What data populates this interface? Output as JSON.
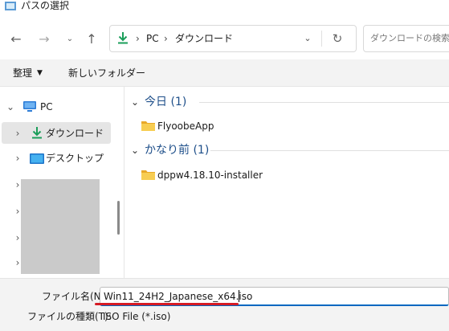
{
  "window": {
    "title": "パスの選択",
    "title_icon": "folder-app-icon"
  },
  "nav": {
    "back": "←",
    "forward": "→",
    "recent": "⌄",
    "up": "↑",
    "address": {
      "segments": [
        "PC",
        "ダウンロード"
      ],
      "separator": "›",
      "dropdown": "⌄",
      "refresh": "↻"
    },
    "search": {
      "placeholder": "ダウンロードの検索"
    }
  },
  "toolbar": {
    "organize": "整理",
    "organize_arrow": "▼",
    "new_folder": "新しいフォルダー"
  },
  "sidebar": {
    "pc": {
      "label": "PC",
      "chevron": "⌄"
    },
    "items": [
      {
        "label": "ダウンロード",
        "chevron": "›",
        "icon": "download-icon",
        "selected": true
      },
      {
        "label": "デスクトップ",
        "chevron": "›",
        "icon": "desktop-icon"
      }
    ],
    "redacted_chevrons": [
      "›",
      "›",
      "›",
      "›"
    ]
  },
  "groups": [
    {
      "label": "今日 (1)",
      "chevron": "⌄",
      "files": [
        {
          "name": "FlyoobeApp",
          "icon": "folder-icon"
        }
      ]
    },
    {
      "label": "かなり前 (1)",
      "chevron": "⌄",
      "files": [
        {
          "name": "dppw4.18.10-installer",
          "icon": "folder-icon"
        }
      ]
    }
  ],
  "footer": {
    "filename_label": "ファイル名(N):",
    "filename_value": "Win11_24H2_Japanese_x64.iso",
    "filetype_label": "ファイルの種類(T):",
    "filetype_value": "ISO File (*.iso)"
  },
  "colors": {
    "accent": "#0067c0",
    "group_header": "#1d4e89",
    "annotation": "#d51b25",
    "folder": "#f4c542"
  }
}
